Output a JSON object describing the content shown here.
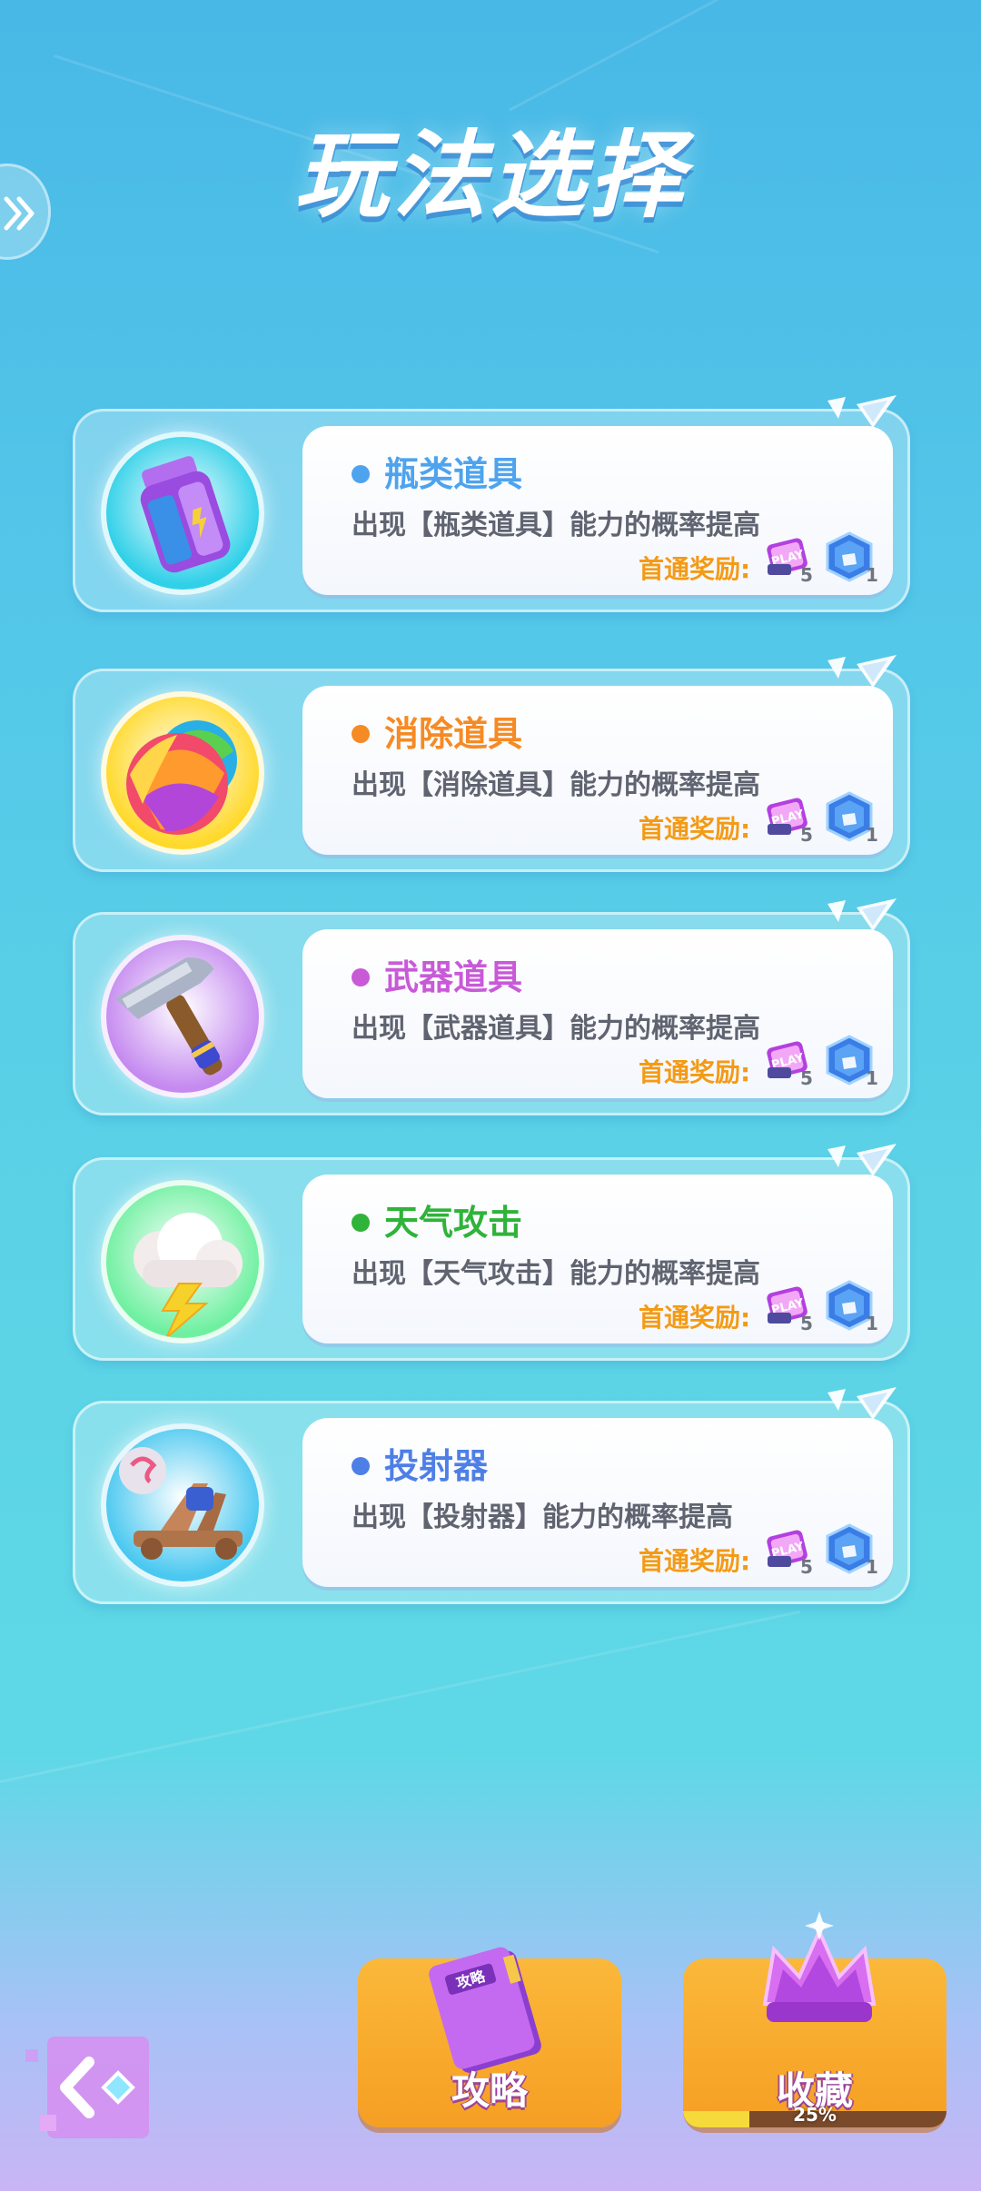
{
  "title": "玩法选择",
  "cards": [
    {
      "name": "瓶类道具",
      "desc": "出现【瓶类道具】能力的概率提高",
      "reward_label": "首通奖励:",
      "ticket_count": "5",
      "gem_count": "1",
      "accent": "#4ea3ef",
      "icon": "bottle-icon",
      "ring": "#2fd0e8"
    },
    {
      "name": "消除道具",
      "desc": "出现【消除道具】能力的概率提高",
      "reward_label": "首通奖励:",
      "ticket_count": "5",
      "gem_count": "1",
      "accent": "#f68a24",
      "icon": "ball-icon",
      "ring": "#ffd92a"
    },
    {
      "name": "武器道具",
      "desc": "出现【武器道具】能力的概率提高",
      "reward_label": "首通奖励:",
      "ticket_count": "5",
      "gem_count": "1",
      "accent": "#c85ad8",
      "icon": "hammer-icon",
      "ring": "#c58af0"
    },
    {
      "name": "天气攻击",
      "desc": "出现【天气攻击】能力的概率提高",
      "reward_label": "首通奖励:",
      "ticket_count": "5",
      "gem_count": "1",
      "accent": "#2fb33a",
      "icon": "storm-cloud-icon",
      "ring": "#6ff0a0"
    },
    {
      "name": "投射器",
      "desc": "出现【投射器】能力的概率提高",
      "reward_label": "首通奖励:",
      "ticket_count": "5",
      "gem_count": "1",
      "accent": "#4e7fe6",
      "icon": "catapult-icon",
      "ring": "#4ac8f0"
    }
  ],
  "buttons": {
    "guide": "攻略",
    "collection": "收藏",
    "collection_progress": "25%",
    "collection_progress_value": 0.25
  }
}
